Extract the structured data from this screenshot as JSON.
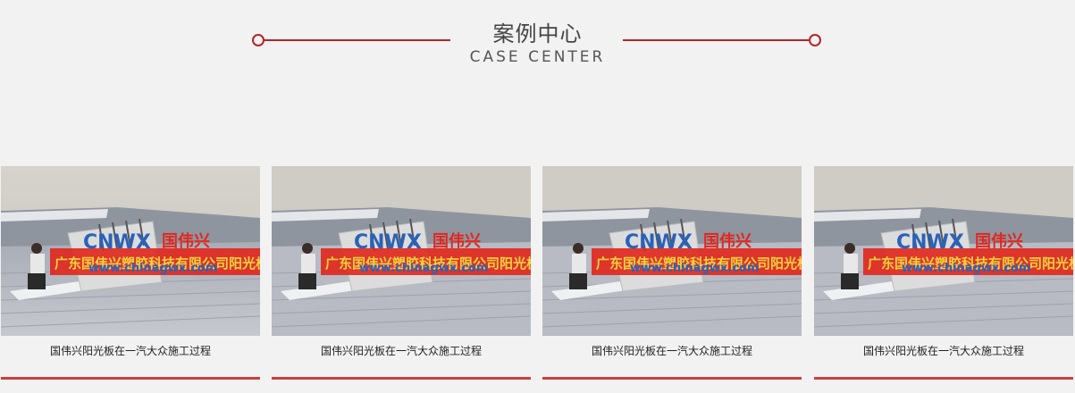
{
  "section": {
    "title_cn": "案例中心",
    "title_en": "CASE CENTER"
  },
  "cards": [
    {
      "caption": "国伟兴阳光板在一汽大众施工过程",
      "banner_logo": "CNWX",
      "banner_brand": "国伟兴",
      "banner_url": "www.chinagwx.com",
      "banner_text": "广东国伟兴塑胶科技有限公司阳光板"
    },
    {
      "caption": "国伟兴阳光板在一汽大众施工过程",
      "banner_logo": "CNWX",
      "banner_brand": "国伟兴",
      "banner_url": "www.chinagwx.com",
      "banner_text": "广东国伟兴塑胶科技有限公司阳光板"
    },
    {
      "caption": "国伟兴阳光板在一汽大众施工过程",
      "banner_logo": "CNWX",
      "banner_brand": "国伟兴",
      "banner_url": "www.chinagwx.com",
      "banner_text": "广东国伟兴塑胶科技有限公司阳光板"
    },
    {
      "caption": "国伟兴阳光板在一汽大众施工过程",
      "banner_logo": "CNWX",
      "banner_brand": "国伟兴",
      "banner_url": "www.chinagwx.com",
      "banner_text": "广东国伟兴塑胶科技有限公司阳光板"
    }
  ],
  "colors": {
    "accent": "#b3262b",
    "card_bar": "#c9413d",
    "background": "#f2f2f2"
  }
}
